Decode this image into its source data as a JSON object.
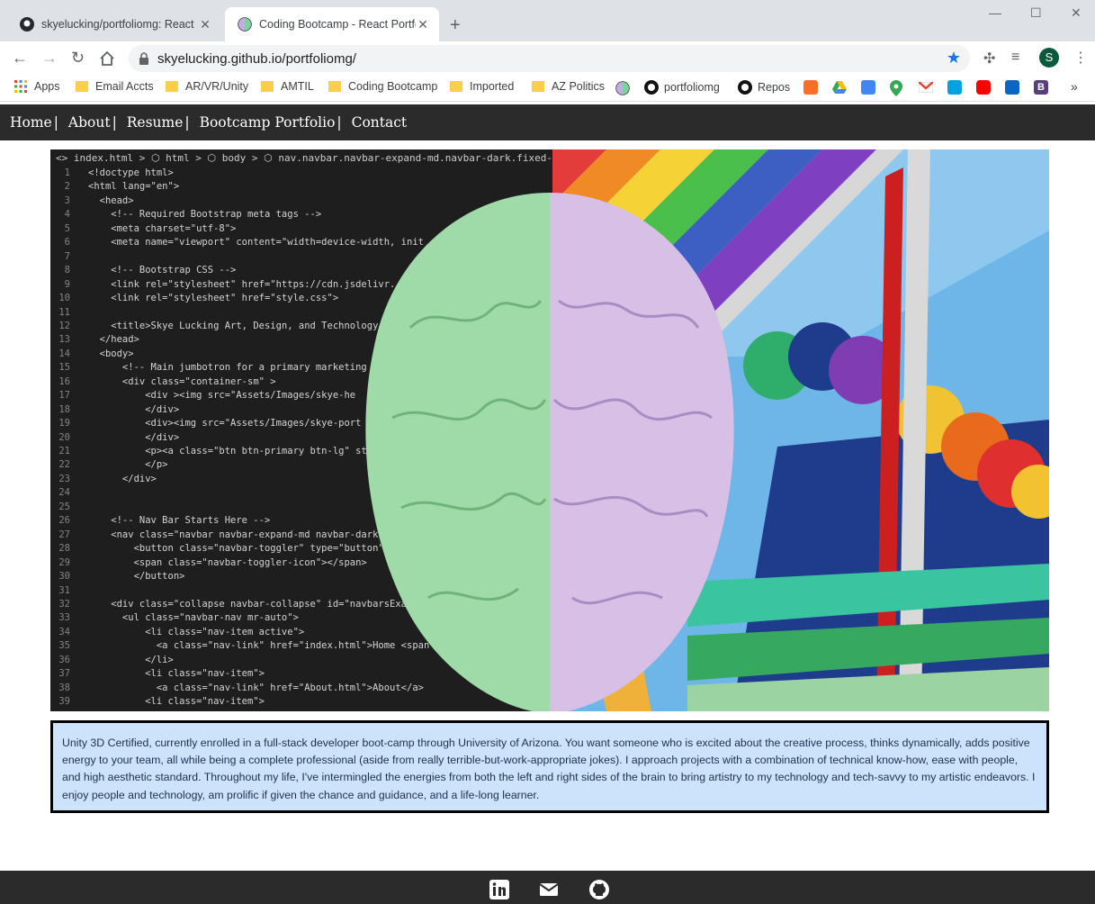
{
  "browser": {
    "tabs": [
      {
        "title": "skyelucking/portfoliomg: React P",
        "active": false
      },
      {
        "title": "Coding Bootcamp - React Portfol",
        "active": true
      }
    ],
    "new_tab": "+",
    "url": "skyelucking.github.io/portfoliomg/",
    "profile_initial": "S",
    "bookmarks": [
      {
        "label": "Apps",
        "icon": "apps-grid-icon"
      },
      {
        "label": "Email Accts",
        "icon": "folder-icon"
      },
      {
        "label": "AR/VR/Unity",
        "icon": "folder-icon"
      },
      {
        "label": "AMTIL",
        "icon": "folder-icon"
      },
      {
        "label": "Coding Bootcamp",
        "icon": "folder-icon"
      },
      {
        "label": "Imported",
        "icon": "folder-icon"
      },
      {
        "label": "AZ Politics",
        "icon": "folder-icon"
      },
      {
        "label": "portfoliomg",
        "icon": "github-icon"
      },
      {
        "label": "Repos",
        "icon": "github-icon"
      }
    ],
    "overflow": "»"
  },
  "site": {
    "nav": [
      "Home",
      "About",
      "Resume",
      "Bootcamp Portfolio",
      "Contact"
    ],
    "nav_separator": "|",
    "hero": {
      "breadcrumb": "<> index.html > ⬡ html > ⬡ body > ⬡ nav.navbar.navbar-expand-md.navbar-dark.fixed-top. > ⬡ div#n",
      "code_lines": [
        "<!doctype html>",
        "<html lang=\"en\">",
        "  <head>",
        "    <!-- Required Bootstrap meta tags -->",
        "    <meta charset=\"utf-8\">",
        "    <meta name=\"viewport\" content=\"width=device-width, init",
        "",
        "    <!-- Bootstrap CSS -->",
        "    <link rel=\"stylesheet\" href=\"https://cdn.jsdelivr.",
        "    <link rel=\"stylesheet\" href=\"style.css\">",
        "",
        "    <title>Skye Lucking Art, Design, and Technology",
        "  </head>",
        "  <body>",
        "      <!-- Main jumbotron for a primary marketing",
        "      <div class=\"container-sm\" >",
        "          <div ><img src=\"Assets/Images/skye-he",
        "          </div>",
        "          <div><img src=\"Assets/Images/skye-port",
        "          </div>",
        "          <p><a class=\"btn btn-primary btn-lg\" st",
        "          </p>",
        "      </div>",
        "",
        "",
        "    <!-- Nav Bar Starts Here -->",
        "    <nav class=\"navbar navbar-expand-md navbar-dark fix",
        "        <button class=\"navbar-toggler\" type=\"button\" data",
        "        <span class=\"navbar-toggler-icon\"></span>",
        "        </button>",
        "",
        "    <div class=\"collapse navbar-collapse\" id=\"navbarsExampleD",
        "      <ul class=\"navbar-nav mr-auto\">",
        "          <li class=\"nav-item active\">",
        "            <a class=\"nav-link\" href=\"index.html\">Home <span class=\"s",
        "          </li>",
        "          <li class=\"nav-item\">",
        "            <a class=\"nav-link\" href=\"About.html\">About</a>",
        "          <li class=\"nav-item\">"
      ]
    },
    "bio": "Unity 3D Certified, currently enrolled in a full-stack developer boot-camp through University of Arizona. You want someone who is excited about the creative process, thinks dynamically, adds positive energy to your team, all while being a complete professional (aside from really terrible-but-work-appropriate jokes). I approach projects with a combination of technical know-how, ease with people, and high aesthetic standard. Throughout my life, I've intermingled the energies from both the left and right sides of the brain to bring artistry to my technology and tech-savvy to my artistic endeavors. I enjoy people and technology, am prolific if given the chance and guidance, and a life-long learner.",
    "footer_icons": [
      "linkedin-icon",
      "email-icon",
      "github-icon"
    ]
  }
}
